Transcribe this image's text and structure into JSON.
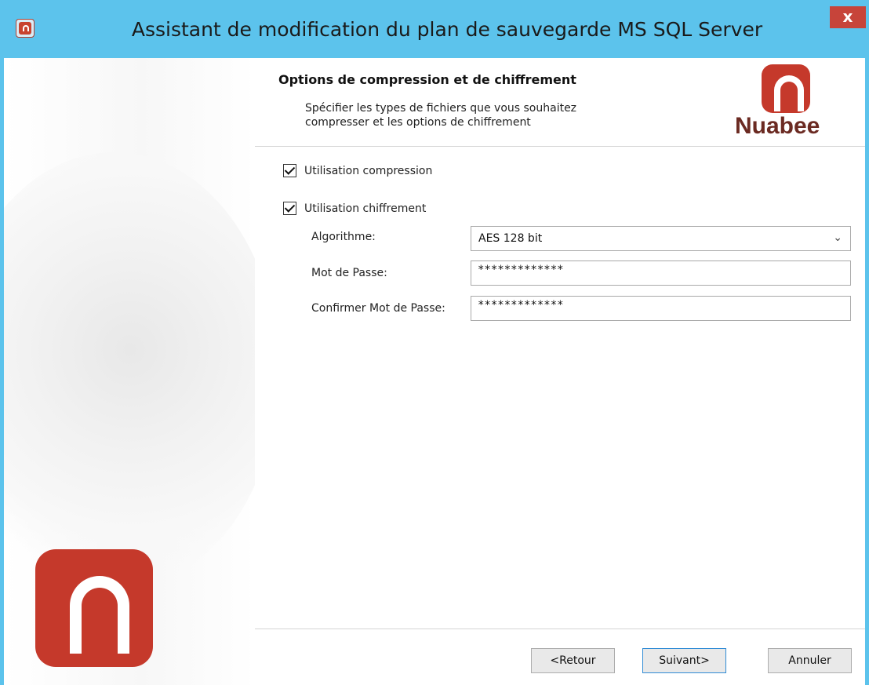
{
  "window": {
    "title": "Assistant de modification du plan de sauvegarde MS SQL Server",
    "close_label": "x"
  },
  "header": {
    "title": "Options de compression et de chiffrement",
    "description_line1": "Spécifier les types de fichiers que vous souhaitez",
    "description_line2": "compresser et les options de chiffrement",
    "brand": "Nuabee"
  },
  "options": {
    "compression": {
      "label": "Utilisation compression",
      "checked": true
    },
    "encryption": {
      "label": "Utilisation chiffrement",
      "checked": true
    }
  },
  "fields": {
    "algorithm": {
      "label": "Algorithme:",
      "value": "AES 128 bit"
    },
    "password": {
      "label": "Mot de Passe:",
      "value": "*************"
    },
    "confirm_password": {
      "label": "Confirmer Mot de Passe:",
      "value": "*************"
    }
  },
  "buttons": {
    "back": "<Retour",
    "next": "Suivant>",
    "cancel": "Annuler"
  },
  "colors": {
    "titlebar": "#5cc3ec",
    "brand_red": "#c5392b",
    "close": "#c7443a"
  },
  "icons": {
    "app": "nuabee-app-icon",
    "close": "close-icon",
    "dropdown": "chevron-down-icon"
  }
}
